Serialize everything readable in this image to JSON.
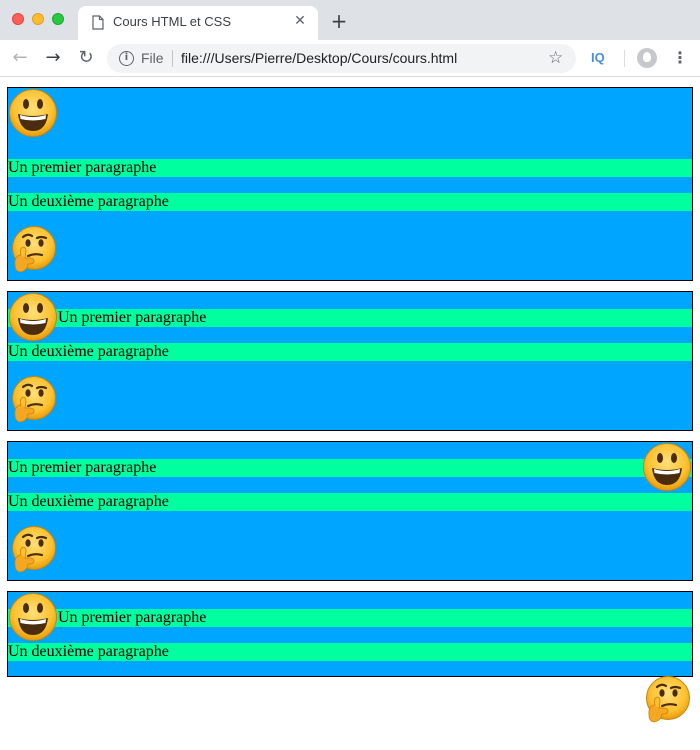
{
  "browser": {
    "tab_title": "Cours HTML et CSS",
    "tab_close": "✕",
    "new_tab": "+",
    "scheme_label": "File",
    "url": "file:///Users/Pierre/Desktop/Cours/cours.html",
    "extension_label": "IQ",
    "icons": {
      "back": "←",
      "forward": "→",
      "reload": "↻",
      "info": "i",
      "bookmark": "☆",
      "menu": "⋮"
    }
  },
  "colors": {
    "block_background": "#00a5ff",
    "paragraph_background": "#00ff9f",
    "border": "#000000"
  },
  "blocks": [
    {
      "paragraphs": [
        "Un premier paragraphe",
        "Un deuxième paragraphe"
      ],
      "emojis": [
        "smiling-emoji",
        "thinking-emoji"
      ]
    },
    {
      "paragraphs": [
        "Un premier paragraphe",
        "Un deuxième paragraphe"
      ],
      "emojis": [
        "smiling-emoji",
        "thinking-emoji"
      ]
    },
    {
      "paragraphs": [
        "Un premier paragraphe",
        "Un deuxième paragraphe"
      ],
      "emojis": [
        "smiling-emoji",
        "thinking-emoji"
      ]
    },
    {
      "paragraphs": [
        "Un premier paragraphe",
        "Un deuxième paragraphe"
      ],
      "emojis": [
        "smiling-emoji",
        "thinking-emoji"
      ]
    }
  ]
}
